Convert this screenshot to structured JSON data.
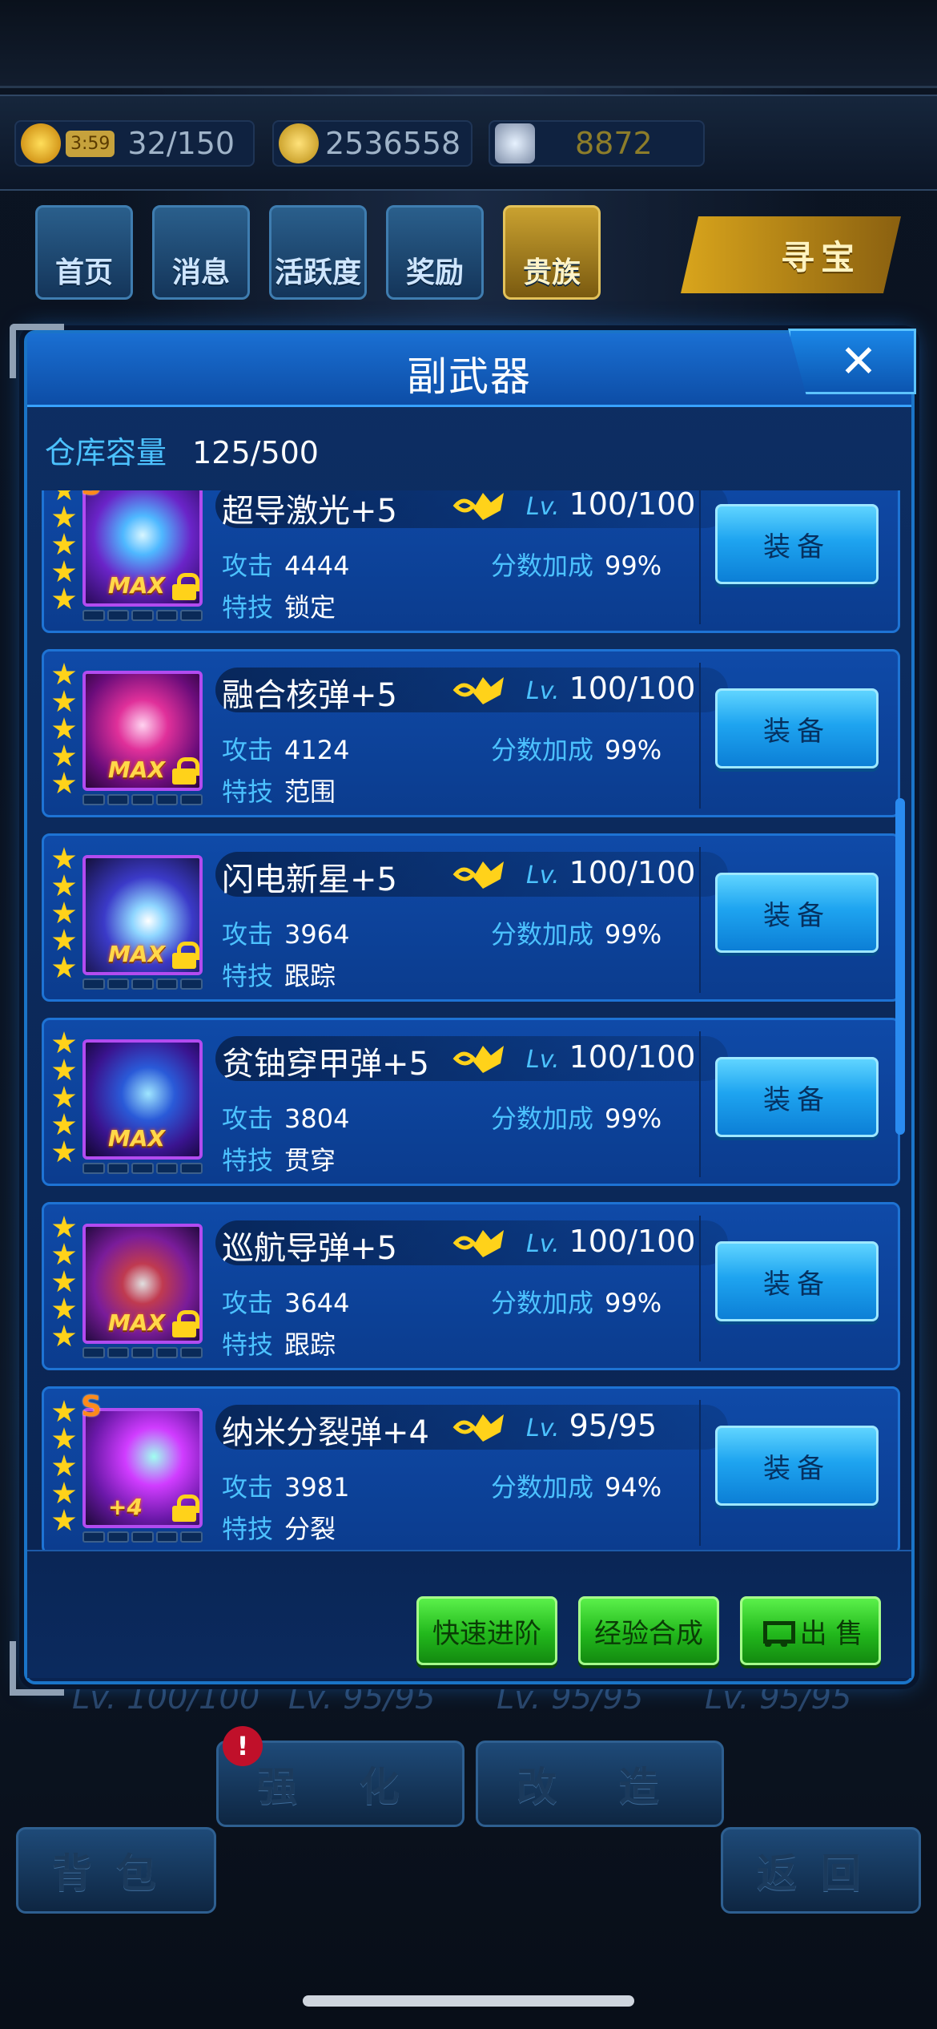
{
  "resources": {
    "energy_timer": "3:59",
    "energy": "32/150",
    "gold": "2536558",
    "diamonds": "8872"
  },
  "nav": {
    "home": "首页",
    "messages": "消息",
    "activity": "活跃度",
    "rewards": "奖励",
    "noble": "贵族",
    "treasure": "寻宝"
  },
  "dialog": {
    "title": "副武器",
    "close_icon": "close-icon",
    "capacity_label": "仓库容量",
    "capacity_value": "125/500"
  },
  "labels": {
    "level_tag": "Lv.",
    "attack": "攻击",
    "score_bonus": "分数加成",
    "skill": "特技",
    "equip": "装备",
    "max": "MAX"
  },
  "items": [
    {
      "name": "超导激光+5",
      "level": "100/100",
      "attack": "4444",
      "bonus": "99%",
      "skill": "锁定",
      "badge": "S",
      "tag": "MAX",
      "locked": true
    },
    {
      "name": "融合核弹+5",
      "level": "100/100",
      "attack": "4124",
      "bonus": "99%",
      "skill": "范围",
      "badge": "",
      "tag": "MAX",
      "locked": true
    },
    {
      "name": "闪电新星+5",
      "level": "100/100",
      "attack": "3964",
      "bonus": "99%",
      "skill": "跟踪",
      "badge": "",
      "tag": "MAX",
      "locked": true
    },
    {
      "name": "贫铀穿甲弹+5",
      "level": "100/100",
      "attack": "3804",
      "bonus": "99%",
      "skill": "贯穿",
      "badge": "",
      "tag": "MAX",
      "locked": false
    },
    {
      "name": "巡航导弹+5",
      "level": "100/100",
      "attack": "3644",
      "bonus": "99%",
      "skill": "跟踪",
      "badge": "",
      "tag": "MAX",
      "locked": true
    },
    {
      "name": "纳米分裂弹+4",
      "level": "95/95",
      "attack": "3981",
      "bonus": "94%",
      "skill": "分裂",
      "badge": "S",
      "tag": "+4",
      "locked": true
    }
  ],
  "footer": {
    "quick_advance": "快速进阶",
    "exp_merge": "经验合成",
    "sell": "出 售"
  },
  "background": {
    "enhance": "强 化",
    "modify": "改 造",
    "backpack": "背包",
    "back": "返回",
    "ghost_levels": [
      "Lv. 100/100",
      "Lv. 95/95",
      "Lv. 95/95",
      "Lv. 95/95"
    ],
    "alert": "!"
  },
  "colors": {
    "accent_blue": "#4cc2ff",
    "equip_button": "#1ea4f0",
    "footer_button": "#22b81c",
    "star": "#ffd21a",
    "item_border": "#b24bf0"
  }
}
